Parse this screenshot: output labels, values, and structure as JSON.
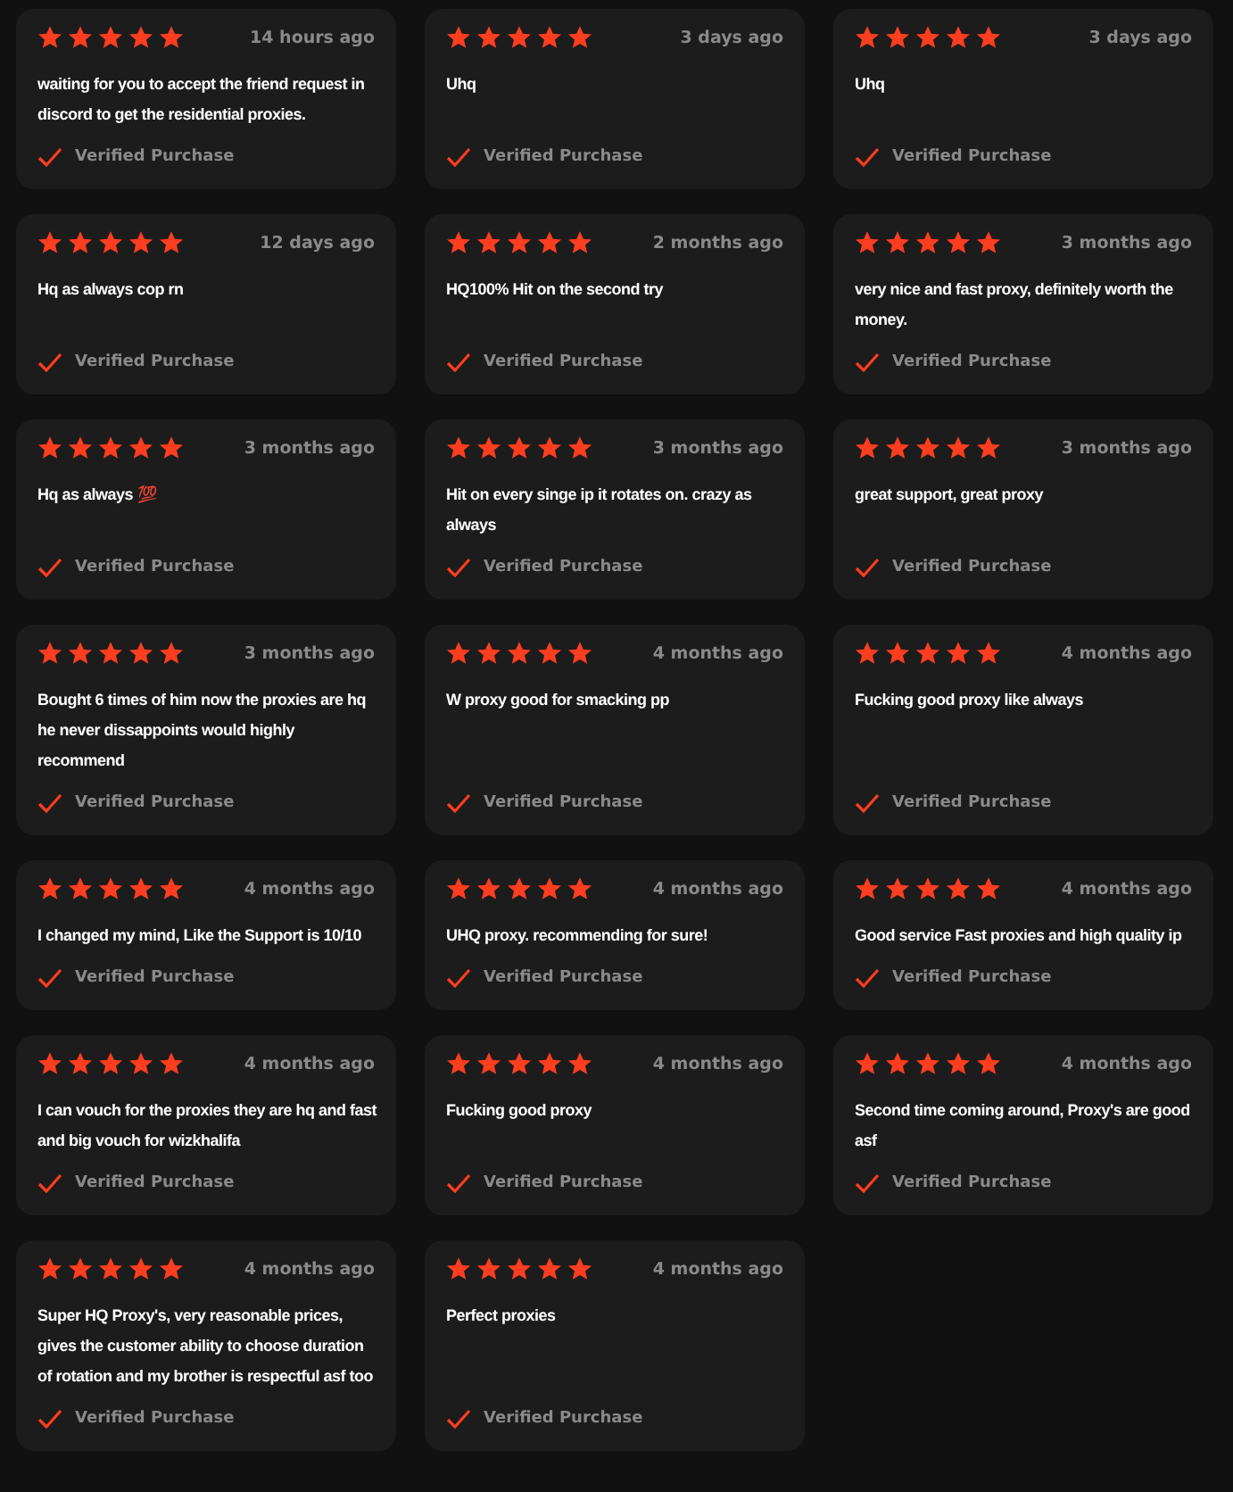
{
  "reviews": [
    {
      "stars": 5,
      "time": "14 hours ago",
      "text": "waiting for you to accept the friend request in discord to get the residential proxies.",
      "badge": "Verified Purchase"
    },
    {
      "stars": 5,
      "time": "3 days ago",
      "text": "Uhq",
      "badge": "Verified Purchase"
    },
    {
      "stars": 5,
      "time": "3 days ago",
      "text": "Uhq",
      "badge": "Verified Purchase"
    },
    {
      "stars": 5,
      "time": "12 days ago",
      "text": "Hq as always cop rn",
      "badge": "Verified Purchase"
    },
    {
      "stars": 5,
      "time": "2 months ago",
      "text": "HQ100% Hit on the second try",
      "badge": "Verified Purchase"
    },
    {
      "stars": 5,
      "time": "3 months ago",
      "text": "very nice and fast proxy, definitely worth the money.",
      "badge": "Verified Purchase"
    },
    {
      "stars": 5,
      "time": "3 months ago",
      "text": "Hq as always 💯",
      "badge": "Verified Purchase"
    },
    {
      "stars": 5,
      "time": "3 months ago",
      "text": "Hit on every singe ip it rotates on. crazy as always",
      "badge": "Verified Purchase"
    },
    {
      "stars": 5,
      "time": "3 months ago",
      "text": "great support, great proxy",
      "badge": "Verified Purchase"
    },
    {
      "stars": 5,
      "time": "3 months ago",
      "text": "Bought 6 times of him now the proxies are hq he never dissappoints would highly recommend",
      "badge": "Verified Purchase"
    },
    {
      "stars": 5,
      "time": "4 months ago",
      "text": "W proxy good for smacking pp",
      "badge": "Verified Purchase"
    },
    {
      "stars": 5,
      "time": "4 months ago",
      "text": "Fucking good proxy like always",
      "badge": "Verified Purchase"
    },
    {
      "stars": 5,
      "time": "4 months ago",
      "text": "I changed my mind, Like the Support is 10/10",
      "badge": "Verified Purchase"
    },
    {
      "stars": 5,
      "time": "4 months ago",
      "text": "UHQ proxy. recommending for sure!",
      "badge": "Verified Purchase"
    },
    {
      "stars": 5,
      "time": "4 months ago",
      "text": "Good service Fast proxies and high quality ip",
      "badge": "Verified Purchase"
    },
    {
      "stars": 5,
      "time": "4 months ago",
      "text": "I can vouch for the proxies they are hq and fast and big vouch for wizkhalifa",
      "badge": "Verified Purchase"
    },
    {
      "stars": 5,
      "time": "4 months ago",
      "text": "Fucking good proxy",
      "badge": "Verified Purchase"
    },
    {
      "stars": 5,
      "time": "4 months ago",
      "text": "Second time coming around, Proxy's are good asf",
      "badge": "Verified Purchase"
    },
    {
      "stars": 5,
      "time": "4 months ago",
      "text": "Super HQ Proxy's, very reasonable prices, gives the customer ability to choose duration of rotation and my brother is respectful asf too",
      "badge": "Verified Purchase"
    },
    {
      "stars": 5,
      "time": "4 months ago",
      "text": "Perfect proxies",
      "badge": "Verified Purchase"
    }
  ]
}
